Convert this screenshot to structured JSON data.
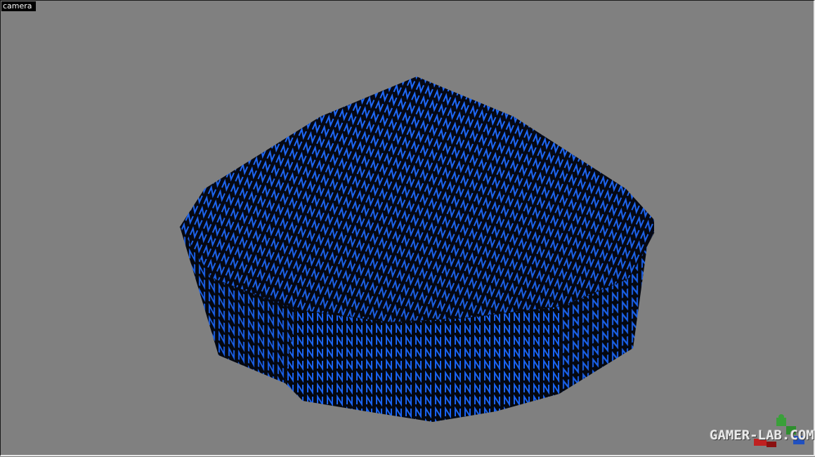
{
  "viewport": {
    "label": "camera"
  },
  "scene": {
    "object": "textured-brush-mesh",
    "texture_glyph": "N",
    "colors": {
      "background": "#808080",
      "texture_base": "#050814",
      "texture_glyph": "#1f6bff"
    }
  },
  "watermark": {
    "text": "GAMER-LAB.COM",
    "icon": "puzzle-logo-icon",
    "colors": {
      "text": "#e9e9e9",
      "logo_green": "#3aa03a",
      "logo_red": "#c02020",
      "logo_blue": "#2050c0"
    }
  }
}
